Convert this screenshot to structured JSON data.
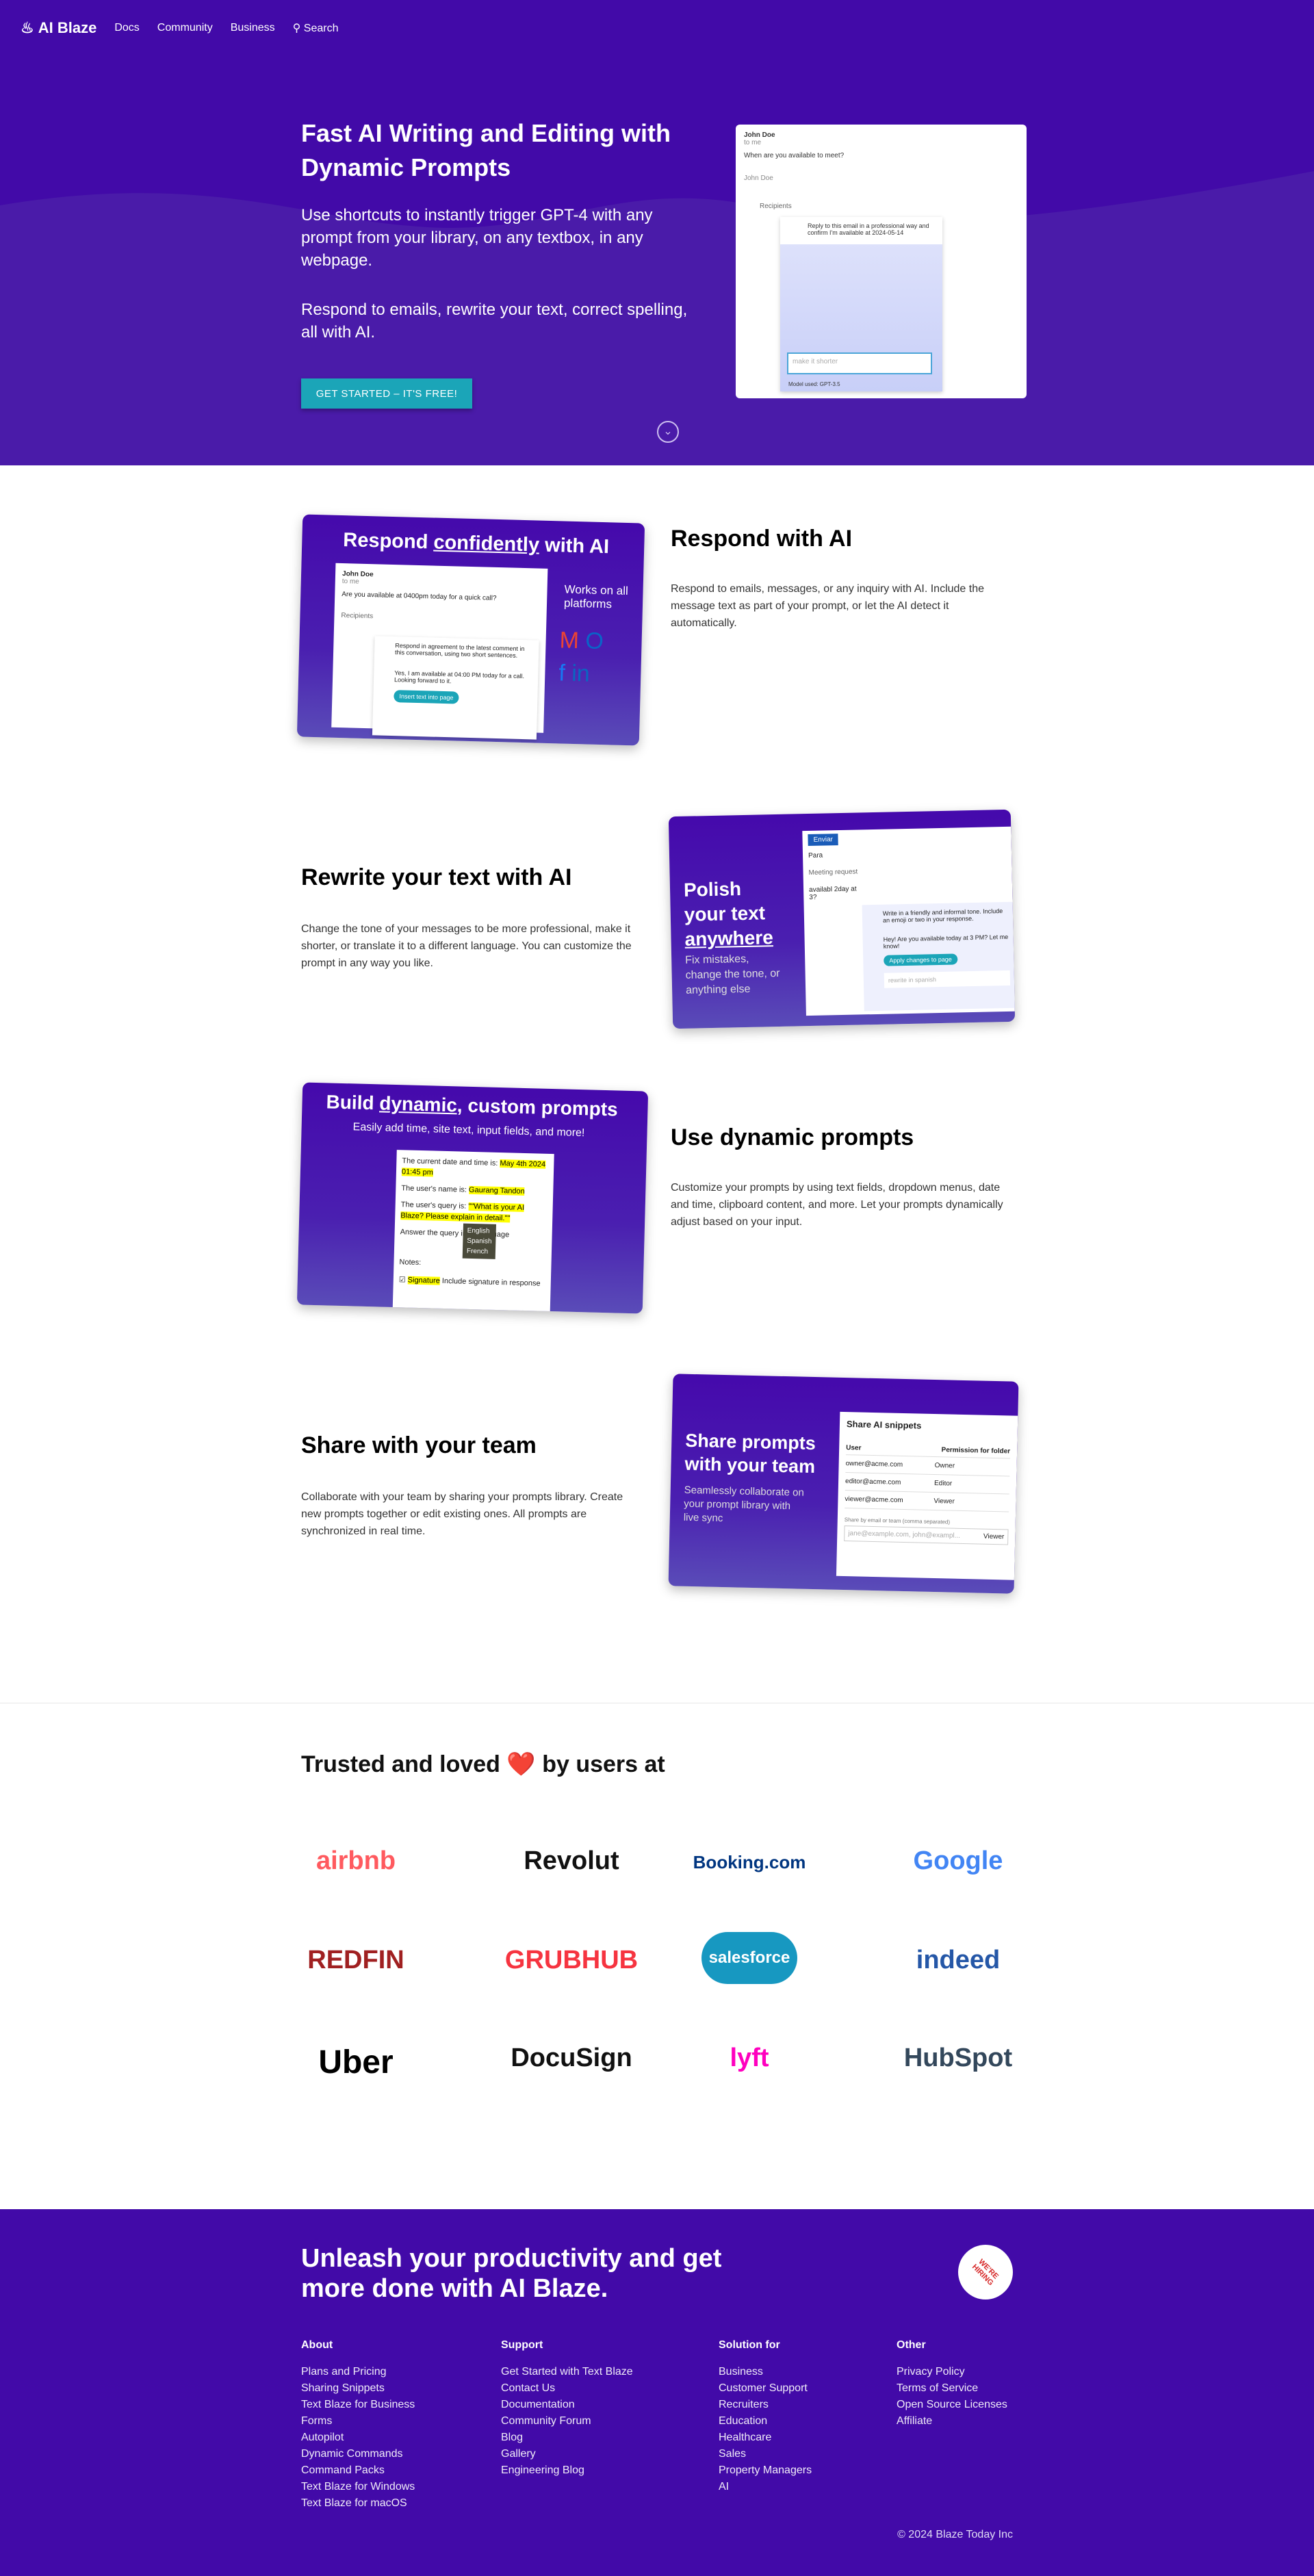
{
  "nav": {
    "brand": "AI Blaze",
    "links": [
      "Docs",
      "Community",
      "Business"
    ],
    "search": "Search"
  },
  "hero": {
    "title": "Fast AI Writing and Editing with Dynamic Prompts",
    "para1": "Use shortcuts to instantly trigger GPT-4 with any prompt from your library, on any textbox, in any webpage.",
    "para2": "Respond to emails, rewrite your text, correct spelling, all with AI.",
    "cta": "GET STARTED –  IT'S FREE!",
    "shot": {
      "sender": "John Doe",
      "to": "to me",
      "question": "When are you available to meet?",
      "sig": "John Doe",
      "recipients": "Recipients",
      "prompt": "Reply to this email in a professional way and confirm I'm available at 2024-05-14",
      "input_placeholder": "make it shorter",
      "model": "Model used: GPT-3.5"
    }
  },
  "features": [
    {
      "title": "Respond with AI",
      "text": "Respond to emails, messages, or any inquiry with AI. Include the message text as part of your prompt, or let the AI detect it automatically.",
      "card": {
        "headline_pre": "Respond ",
        "headline_em": "confidently",
        "headline_post": " with AI",
        "side": "Works on all platforms",
        "sender": "John Doe",
        "to": "to me",
        "question": "Are you available at 0400pm today for a quick call?",
        "recipients": "Recipients",
        "prompt": "Respond in agreement to the latest comment in this conversation, using two short sentences.",
        "reply": "Yes, I am available at 04:00 PM today for a call. Looking forward to it.",
        "button": "Insert text into page"
      }
    },
    {
      "title": "Rewrite your text with AI",
      "text": "Change the tone of your messages to be more professional, make it shorter, or translate it to a different language. You can customize the prompt in any way you like.",
      "card": {
        "l1": "Polish",
        "l2": "your text",
        "l3": "anywhere",
        "sub": "Fix mistakes, change the tone, or anything else",
        "send": "Enviar",
        "to": "Para",
        "subject": "Meeting request",
        "draft": "availabl 2day at 3?",
        "prompt": "Write in a friendly and informal tone. Include an emoji or two in your response.",
        "reply": "Hey! Are you available today at 3 PM? Let me know!",
        "button": "Apply changes to page",
        "input": "rewrite in spanish"
      }
    },
    {
      "title": "Use dynamic prompts",
      "text": "Customize your prompts by using text fields, dropdown menus, date and time, clipboard content, and more. Let your prompts dynamically adjust based on your input.",
      "card": {
        "headline_pre": "Build ",
        "headline_em": "dynamic",
        "headline_post": ", custom prompts",
        "sub": "Easily add time, site text, input fields, and more!",
        "date_label": "The current date and time is:",
        "date_val": "May 4th 2024 01:45 pm",
        "name_label": "The user's name is:",
        "name_val": "Gaurang Tandon",
        "query_label": "The user's query is:",
        "query_val": "\"\"What is your AI Blaze? Please explain in detail.\"\"",
        "answer": "Answer the query in",
        "language": "language",
        "options": [
          "English",
          "Spanish",
          "French"
        ],
        "notes": "Notes:",
        "sig": "Signature",
        "sig_text": "Include signature in response"
      }
    },
    {
      "title": "Share with your team",
      "text": "Collaborate with your team by sharing your prompts library. Create new prompts together or edit existing ones. All prompts are synchronized in real time.",
      "card": {
        "l1": "Share prompts",
        "l2": "with your team",
        "sub": "Seamlessly collaborate on your prompt library with live sync",
        "dialog": "Share AI snippets",
        "col_user": "User",
        "col_perm": "Permission for folder",
        "rows": [
          [
            "owner@acme.com",
            "Owner"
          ],
          [
            "editor@acme.com",
            "Editor"
          ],
          [
            "viewer@acme.com",
            "Viewer"
          ]
        ],
        "share_label": "Share by email or team (comma separated)",
        "share_placeholder": "jane@example.com, john@exampl...",
        "share_role": "Viewer"
      }
    }
  ],
  "trusted": {
    "pre": "Trusted and loved",
    "post": "by users at",
    "heart": "❤️",
    "logos": [
      {
        "name": "airbnb",
        "color": "#ff5a5f"
      },
      {
        "name": "Revolut",
        "color": "#111111"
      },
      {
        "name": "Booking.com",
        "color": "#003580"
      },
      {
        "name": "Google",
        "color": "#4285f4"
      },
      {
        "name": "REDFIN",
        "color": "#a02021"
      },
      {
        "name": "GRUBHUB",
        "color": "#f63440"
      },
      {
        "name": "salesforce",
        "color": "#1798c1"
      },
      {
        "name": "indeed",
        "color": "#2557a7"
      },
      {
        "name": "Uber",
        "color": "#000000"
      },
      {
        "name": "DocuSign",
        "color": "#111111"
      },
      {
        "name": "lyft",
        "color": "#ff00bf"
      },
      {
        "name": "HubSpot",
        "color": "#33475b"
      }
    ]
  },
  "footer": {
    "title": "Unleash your productivity and get more done with AI Blaze.",
    "badge": "WE'RE HIRING",
    "columns": [
      {
        "heading": "About",
        "links": [
          "Plans and Pricing",
          "Sharing Snippets",
          "Text Blaze for Business",
          "Forms",
          "Autopilot",
          "Dynamic Commands",
          "Command Packs",
          "Text Blaze for Windows",
          "Text Blaze for macOS"
        ]
      },
      {
        "heading": "Support",
        "links": [
          "Get Started with Text Blaze",
          "Contact Us",
          "Documentation",
          "Community Forum",
          "Blog",
          "Gallery",
          "Engineering Blog"
        ]
      },
      {
        "heading": "Solution for",
        "links": [
          "Business",
          "Customer Support",
          "Recruiters",
          "Education",
          "Healthcare",
          "Sales",
          "Property Managers",
          "AI"
        ]
      },
      {
        "heading": "Other",
        "links": [
          "Privacy Policy",
          "Terms of Service",
          "Open Source Licenses",
          "Affiliate"
        ]
      }
    ],
    "copyright": "© 2024 Blaze Today Inc"
  },
  "colors": {
    "brand": "#420aa8",
    "cta": "#1ba5b8"
  }
}
